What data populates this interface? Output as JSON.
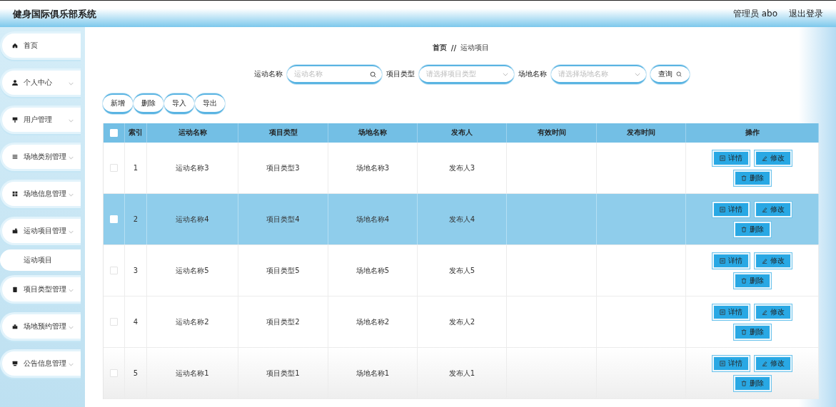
{
  "header": {
    "title": "健身国际俱乐部系统",
    "user": "管理员 abo",
    "logout": "退出登录"
  },
  "sidebar": {
    "items": [
      {
        "label": "首页",
        "kind": "link"
      },
      {
        "label": "个人中心",
        "kind": "menu"
      },
      {
        "label": "用户管理",
        "kind": "menu"
      },
      {
        "label": "场地类别管理",
        "kind": "menu"
      },
      {
        "label": "场地信息管理",
        "kind": "menu"
      },
      {
        "label": "运动项目管理",
        "kind": "menu",
        "children": [
          {
            "label": "运动项目"
          }
        ]
      },
      {
        "label": "项目类型管理",
        "kind": "menu"
      },
      {
        "label": "场地预约管理",
        "kind": "menu"
      },
      {
        "label": "公告信息管理",
        "kind": "menu"
      }
    ]
  },
  "breadcrumb": {
    "home": "首页",
    "separator": "//",
    "current": "运动项目"
  },
  "search": {
    "fields": [
      {
        "label": "运动名称",
        "placeholder": "运动名称",
        "kind": "text"
      },
      {
        "label": "项目类型",
        "placeholder": "请选择项目类型",
        "kind": "select"
      },
      {
        "label": "场地名称",
        "placeholder": "请选择场地名称",
        "kind": "select"
      }
    ],
    "button": "查询"
  },
  "toolbar": [
    "新增",
    "删除",
    "导入",
    "导出"
  ],
  "table": {
    "select_all": {
      "checked": false
    },
    "columns": [
      "索引",
      "运动名称",
      "项目类型",
      "场地名称",
      "发布人",
      "有效时间",
      "发布时间",
      "操作"
    ],
    "rows": [
      {
        "index": "1",
        "name": "运动名称3",
        "type": "项目类型3",
        "venue": "场地名称3",
        "publisher": "发布人3",
        "selected": false,
        "actions": [
          "详情",
          "修改",
          "删除"
        ]
      },
      {
        "index": "2",
        "name": "运动名称4",
        "type": "项目类型4",
        "venue": "场地名称4",
        "publisher": "发布人4",
        "selected": true,
        "actions": [
          "详情",
          "修改",
          "删除"
        ]
      },
      {
        "index": "3",
        "name": "运动名称5",
        "type": "项目类型5",
        "venue": "场地名称5",
        "publisher": "发布人5",
        "selected": false,
        "actions": [
          "详情",
          "修改",
          "删除"
        ]
      },
      {
        "index": "4",
        "name": "运动名称2",
        "type": "项目类型2",
        "venue": "场地名称2",
        "publisher": "发布人2",
        "selected": false,
        "actions": [
          "详情",
          "修改",
          "删除"
        ]
      },
      {
        "index": "5",
        "name": "运动名称1",
        "type": "项目类型1",
        "venue": "场地名称1",
        "publisher": "发布人1",
        "selected": false,
        "actions": [
          "详情",
          "修改",
          "删除"
        ]
      }
    ]
  }
}
